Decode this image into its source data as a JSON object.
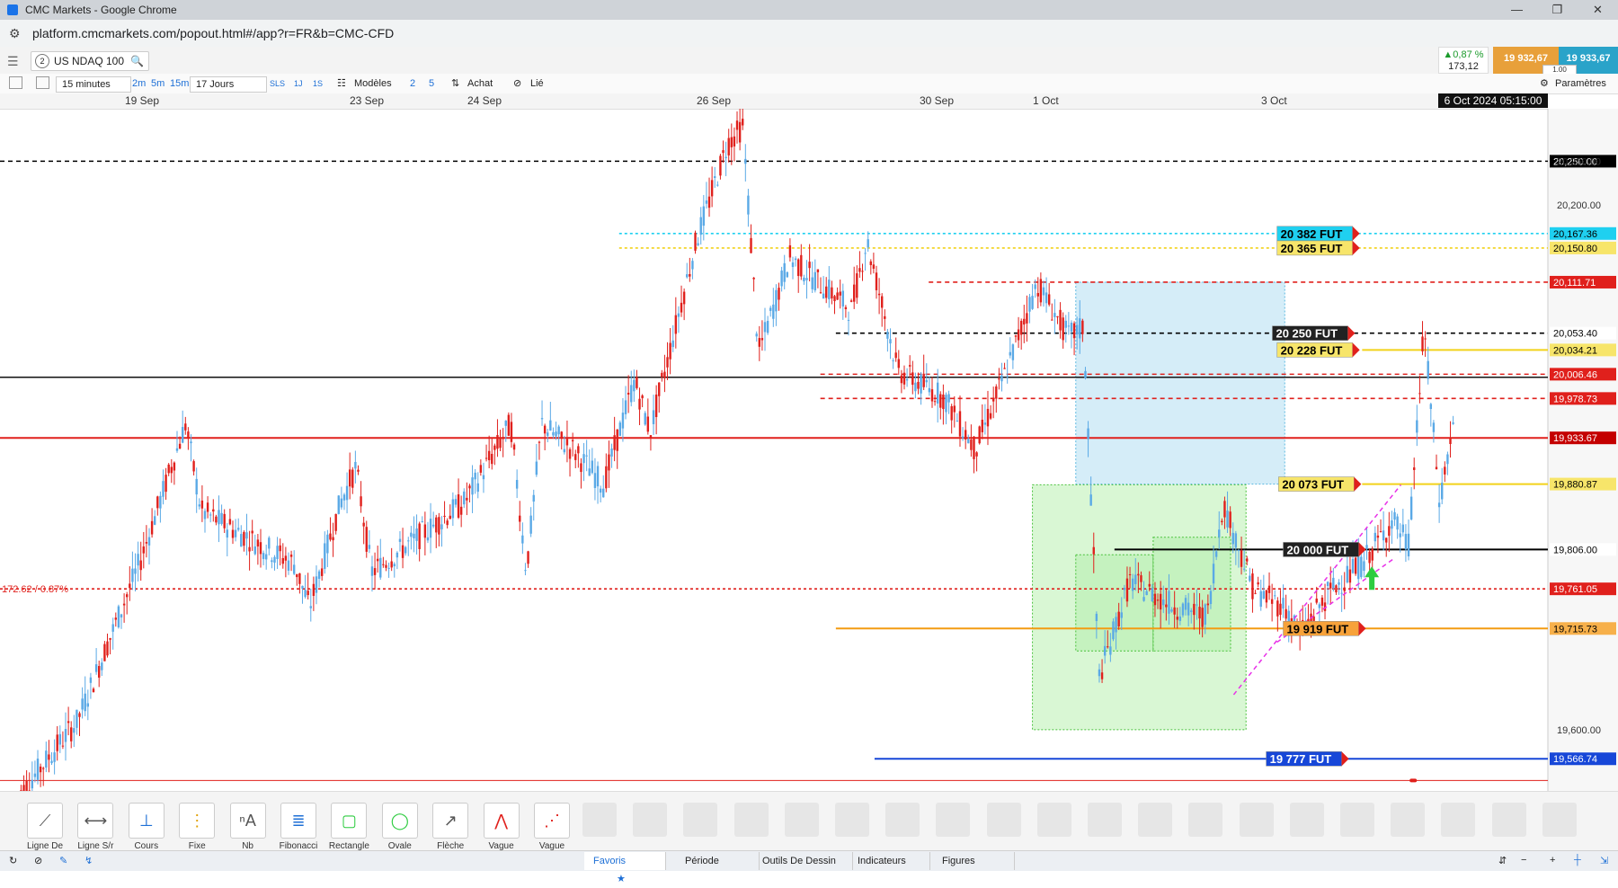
{
  "browser": {
    "window_title": "CMC Markets - Google Chrome",
    "url": "platform.cmcmarkets.com/popout.html#/app?r=FR&b=CMC-CFD"
  },
  "header": {
    "instrument_number": "2",
    "instrument": "US NDAQ 100",
    "change_pct": "▲0,87 %",
    "change_pts": "173,12",
    "sell_price": "19 932,67",
    "buy_price": "19 933,67",
    "quantity": "1.00"
  },
  "toolbar": {
    "interval": "15 minutes",
    "quick_intervals": [
      "2m",
      "5m",
      "15m"
    ],
    "period": "17 Jours",
    "quick_periods": [
      "SLS",
      "1J",
      "1S"
    ],
    "templates_label": "Modèles",
    "num_a": "2",
    "num_b": "5",
    "trade_label": "Achat",
    "linked_label": "Lié",
    "settings_label": "Paramètres"
  },
  "date_axis": {
    "labels": [
      {
        "text": "19 Sep",
        "pos": 0.081
      },
      {
        "text": "23 Sep",
        "pos": 0.226
      },
      {
        "text": "24 Sep",
        "pos": 0.302
      },
      {
        "text": "26 Sep",
        "pos": 0.45
      },
      {
        "text": "30 Sep",
        "pos": 0.594
      },
      {
        "text": "1 Oct",
        "pos": 0.667
      },
      {
        "text": "3 Oct",
        "pos": 0.815
      }
    ],
    "cursor_time": "6 Oct 2024 05:15:00"
  },
  "chart_data": {
    "type": "candlestick",
    "instrument": "US NDAQ 100",
    "timeframe": "15 minutes",
    "price_axis_ticks": [
      "20,250.00",
      "20,200.00",
      "19,600.00"
    ],
    "y_range": [
      19530,
      20310
    ],
    "current_price": "19,933.67",
    "percent_marker": "172.62 / 0.87%",
    "levels": [
      {
        "price": 20250.0,
        "label": "20,250.00",
        "color": "#000000",
        "style": "dashed",
        "tag_bg": "#000000",
        "tag_fg": "#ffffff"
      },
      {
        "price": 20167.36,
        "label": "20,167.36",
        "color": "#1fd0f0",
        "style": "dotted",
        "tag_bg": "#1fd0f0",
        "tag_fg": "#000000"
      },
      {
        "price": 20150.8,
        "label": "20,150.80",
        "color": "#f2d21a",
        "style": "dotted",
        "tag_bg": "#f7e56a",
        "tag_fg": "#000000"
      },
      {
        "price": 20111.71,
        "label": "20,111.71",
        "color": "#e0201c",
        "style": "dashed",
        "tag_bg": "#e0201c",
        "tag_fg": "#ffffff"
      },
      {
        "price": 20053.4,
        "label": "20,053.40",
        "color": "#000000",
        "style": "dashed",
        "tag_bg": "#ffffff",
        "tag_fg": "#000000"
      },
      {
        "price": 20034.21,
        "label": "20,034.21",
        "color": "#f2d21a",
        "style": "solid",
        "tag_bg": "#f7e56a",
        "tag_fg": "#000000"
      },
      {
        "price": 20006.46,
        "label": "20,006.46",
        "color": "#e0201c",
        "style": "dashed",
        "tag_bg": "#e0201c",
        "tag_fg": "#ffffff"
      },
      {
        "price": 19978.73,
        "label": "19,978.73",
        "color": "#e0201c",
        "style": "dashed",
        "tag_bg": "#e0201c",
        "tag_fg": "#ffffff"
      },
      {
        "price": 19933.67,
        "label": "19,933.67",
        "color": "#e0201c",
        "style": "solid",
        "tag_bg": "#c40000",
        "tag_fg": "#ffffff"
      },
      {
        "price": 19880.87,
        "label": "19,880.87",
        "color": "#f2d21a",
        "style": "solid",
        "tag_bg": "#f7e56a",
        "tag_fg": "#000000"
      },
      {
        "price": 19806.0,
        "label": "19,806.00",
        "color": "#000000",
        "style": "solid",
        "tag_bg": "#ffffff",
        "tag_fg": "#000000"
      },
      {
        "price": 19761.05,
        "label": "19,761.05",
        "color": "#e0201c",
        "style": "dotted",
        "tag_bg": "#e0201c",
        "tag_fg": "#ffffff"
      },
      {
        "price": 19715.73,
        "label": "19,715.73",
        "color": "#f39c12",
        "style": "solid",
        "tag_bg": "#f7b04a",
        "tag_fg": "#000000"
      },
      {
        "price": 19566.74,
        "label": "19,566.74",
        "color": "#1747d8",
        "style": "solid",
        "tag_bg": "#1747d8",
        "tag_fg": "#ffffff"
      }
    ],
    "fut_labels": [
      {
        "text": "20 382 FUT",
        "price": 20167.36,
        "bg": "#1fd0f0"
      },
      {
        "text": "20 365 FUT",
        "price": 20150.8,
        "bg": "#f7e56a"
      },
      {
        "text": "20 250 FUT",
        "price": 20053.4,
        "bg": "#222222"
      },
      {
        "text": "20 228 FUT",
        "price": 20034.21,
        "bg": "#f7e56a"
      },
      {
        "text": "20 073 FUT",
        "price": 19880.87,
        "bg": "#f7e56a"
      },
      {
        "text": "20 000 FUT",
        "price": 19806.0,
        "bg": "#222222"
      },
      {
        "text": "19 919 FUT",
        "price": 19715.73,
        "bg": "#f7a23a"
      },
      {
        "text": "19 777 FUT",
        "price": 19566.74,
        "bg": "#1747d8"
      }
    ],
    "price_path": [
      [
        0.01,
        19520
      ],
      [
        0.05,
        19610
      ],
      [
        0.09,
        19790
      ],
      [
        0.12,
        19950
      ],
      [
        0.13,
        19850
      ],
      [
        0.16,
        19820
      ],
      [
        0.19,
        19790
      ],
      [
        0.2,
        19740
      ],
      [
        0.22,
        19860
      ],
      [
        0.23,
        19900
      ],
      [
        0.24,
        19780
      ],
      [
        0.27,
        19820
      ],
      [
        0.3,
        19860
      ],
      [
        0.33,
        19950
      ],
      [
        0.34,
        19780
      ],
      [
        0.35,
        19950
      ],
      [
        0.37,
        19920
      ],
      [
        0.39,
        19880
      ],
      [
        0.41,
        20000
      ],
      [
        0.42,
        19940
      ],
      [
        0.45,
        20160
      ],
      [
        0.47,
        20270
      ],
      [
        0.48,
        20290
      ],
      [
        0.49,
        20030
      ],
      [
        0.51,
        20140
      ],
      [
        0.55,
        20080
      ],
      [
        0.56,
        20160
      ],
      [
        0.58,
        20010
      ],
      [
        0.61,
        19980
      ],
      [
        0.63,
        19920
      ],
      [
        0.65,
        20010
      ],
      [
        0.67,
        20110
      ],
      [
        0.69,
        20050
      ],
      [
        0.7,
        20060
      ],
      [
        0.71,
        19660
      ],
      [
        0.73,
        19770
      ],
      [
        0.76,
        19740
      ],
      [
        0.78,
        19730
      ],
      [
        0.79,
        19860
      ],
      [
        0.81,
        19760
      ],
      [
        0.83,
        19740
      ],
      [
        0.84,
        19710
      ],
      [
        0.86,
        19760
      ],
      [
        0.88,
        19790
      ],
      [
        0.9,
        19840
      ],
      [
        0.91,
        19810
      ],
      [
        0.92,
        20060
      ],
      [
        0.93,
        19860
      ],
      [
        0.94,
        19960
      ]
    ]
  },
  "drawing_tools": [
    {
      "name": "Ligne De ...",
      "key": "line"
    },
    {
      "name": "Ligne S/r",
      "key": "sr"
    },
    {
      "name": "Cours",
      "key": "price"
    },
    {
      "name": "Fixe",
      "key": "fixed"
    },
    {
      "name": "Nb",
      "key": "text"
    },
    {
      "name": "Fibonacci",
      "key": "fib"
    },
    {
      "name": "Rectangle",
      "key": "rect"
    },
    {
      "name": "Ovale",
      "key": "oval"
    },
    {
      "name": "Flèche",
      "key": "arrow"
    },
    {
      "name": "Vague Mo...",
      "key": "wave1"
    },
    {
      "name": "Vague Co...",
      "key": "wave2"
    }
  ],
  "footer_tabs": [
    "Favoris",
    "Période",
    "Outils De Dessin",
    "Indicateurs",
    "Figures"
  ]
}
